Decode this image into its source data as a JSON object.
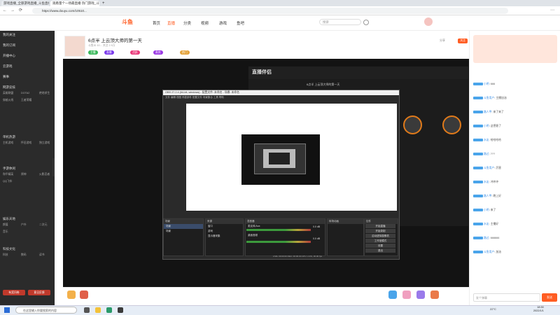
{
  "browser": {
    "tabs": [
      {
        "title": "游戏直播_全部游戏直播_斗鱼直播"
      },
      {
        "title": "观看量个一场最直播 热门游戏_斗鱼"
      }
    ],
    "new_tab": "+",
    "url": "https://www.douyu.com/10510...",
    "back": "←",
    "forward": "→",
    "refresh": "⟳",
    "menu": "⋯"
  },
  "site": {
    "logo": "斗鱼",
    "nav": [
      {
        "label": "首页",
        "active": false
      },
      {
        "label": "直播",
        "active": true
      },
      {
        "label": "分类",
        "active": false
      },
      {
        "label": "视频",
        "active": false
      },
      {
        "label": "游戏",
        "active": false
      },
      {
        "label": "鱼吧",
        "active": false
      }
    ],
    "search_placeholder": "搜索"
  },
  "sidebar": {
    "items": [
      {
        "label": "我的关注"
      },
      {
        "label": "我的订阅"
      },
      {
        "label": "开播中心"
      },
      {
        "label": "云游戏"
      },
      {
        "label": "赛事"
      }
    ],
    "sections": [
      {
        "title": "网游竞技",
        "entries": [
          "英雄联盟",
          "DOTA2",
          "绝地求生",
          "穿越火线",
          "王者荣耀"
        ]
      },
      {
        "title": "单机热游",
        "entries": [
          "主机游戏",
          "怀旧游戏",
          "独立游戏"
        ]
      },
      {
        "title": "手游休闲",
        "entries": [
          "和平精英",
          "原神",
          "火影忍者",
          "QQ飞车"
        ]
      },
      {
        "title": "娱乐天地",
        "entries": [
          "颜值",
          "户外",
          "二次元",
          "音乐"
        ]
      },
      {
        "title": "科技文化",
        "entries": [
          "科技",
          "数码",
          "读书"
        ]
      }
    ],
    "bottom_buttons": [
      "有奖问卷",
      "意见反馈"
    ]
  },
  "room": {
    "title": "6点半 上云顶大师的第一天",
    "meta": "斗鱼ID 10... 关注 2.9万",
    "tags": [
      {
        "label": "主播",
        "color": "#3ab85a"
      },
      {
        "label": "直播",
        "color": "#7a3aeb"
      },
      {
        "label": "活跃",
        "color": "#e93a7a"
      },
      {
        "label": "贵宾",
        "color": "#9a3ae3"
      },
      {
        "label": "热门",
        "color": "#e3a23a"
      }
    ],
    "follow_label": "关注",
    "share_label": "分享"
  },
  "obs": {
    "window_title": "OBS 27.2.4 (64-bit, windows) - 配置文件: 未命名 - 场景: 未命名",
    "menu": [
      "文件",
      "编辑",
      "视图",
      "停靠部件",
      "配置文件",
      "场景集合",
      "工具",
      "帮助"
    ],
    "panels": [
      {
        "title": "场景"
      },
      {
        "title": "来源"
      },
      {
        "title": "混音器"
      },
      {
        "title": "转场动画"
      },
      {
        "title": "控件"
      }
    ],
    "scenes": [
      "场景",
      "场景"
    ],
    "sources": [
      "窗口",
      "游戏",
      "显示器采集"
    ],
    "mixer": [
      {
        "label": "麦克风/Aux",
        "value": "0.0 dB"
      },
      {
        "label": "桌面音频",
        "value": "0.0 dB"
      }
    ],
    "controls": [
      "开始直播",
      "开始录制",
      "启动虚拟摄像机",
      "工作室模式",
      "设置",
      "退出"
    ],
    "statusbar": "LIVE: 00:00:00  REC: 00:00:00  CPU: 2.4%, 30.00 fps"
  },
  "backapp": {
    "title": "直播伴侣",
    "stream_title": "6点半 上云顶大师的第一天"
  },
  "chat": {
    "messages": [
      {
        "user": "小明",
        "text": "666"
      },
      {
        "user": "斗鱼用户",
        "text": "主播加油"
      },
      {
        "user": "路人甲",
        "text": "来了来了"
      },
      {
        "user": "小明",
        "text": "这把稳了"
      },
      {
        "user": "水友",
        "text": "哈哈哈哈"
      },
      {
        "user": "路过",
        "text": "???"
      },
      {
        "user": "斗鱼用户",
        "text": "厉害"
      },
      {
        "user": "水友",
        "text": "冲冲冲"
      },
      {
        "user": "路人甲",
        "text": "晚上好"
      },
      {
        "user": "小明",
        "text": "来了"
      },
      {
        "user": "水友",
        "text": "主播好"
      },
      {
        "user": "路过",
        "text": "666666"
      },
      {
        "user": "斗鱼用户",
        "text": "加油"
      }
    ],
    "input_placeholder": "发个弹幕",
    "send_label": "发送"
  },
  "taskbar": {
    "search_placeholder": "在这里输入你要搜索的内容",
    "temperature": "22°C",
    "time": "18:30",
    "date": "2022/1/1"
  }
}
